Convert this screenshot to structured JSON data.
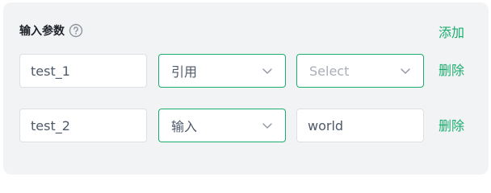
{
  "header": {
    "title": "输入参数",
    "add_label": "添加"
  },
  "rows": [
    {
      "name_value": "test_1",
      "type_value": "引用",
      "value_placeholder": "Select",
      "delete_label": "删除"
    },
    {
      "name_value": "test_2",
      "type_value": "输入",
      "value_text": "world",
      "delete_label": "删除"
    }
  ],
  "colors": {
    "accent": "#1aad6e",
    "panel_bg": "#f2f3f5",
    "border": "#dde0e4",
    "placeholder": "#a9aeb8",
    "text": "#4e5969"
  },
  "icons": [
    "help-circle-icon",
    "chevron-down-icon"
  ]
}
